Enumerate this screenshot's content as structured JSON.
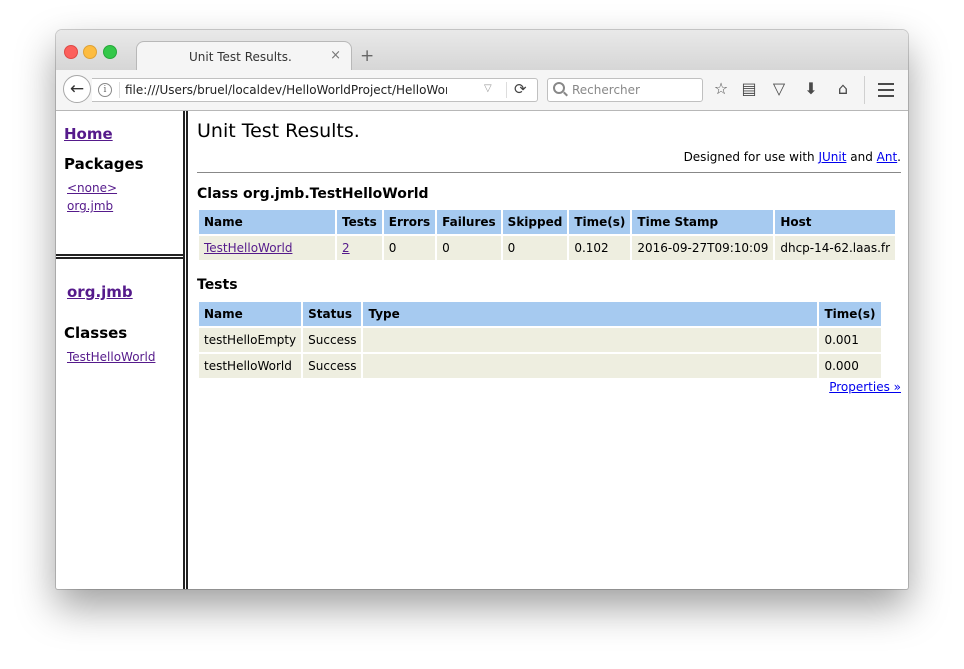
{
  "browser": {
    "tab_title": "Unit Test Results.",
    "tab_close": "×",
    "new_tab": "+",
    "url": "file:///Users/bruel/localdev/HelloWorldProject/HelloWorld/junit",
    "search_placeholder": "Rechercher"
  },
  "nav": {
    "home": "Home",
    "packages_heading": "Packages",
    "packages": [
      "<none>",
      "org.jmb"
    ],
    "package_name": "org.jmb",
    "classes_heading": "Classes",
    "classes": [
      "TestHelloWorld"
    ]
  },
  "main": {
    "title": "Unit Test Results.",
    "designed_prefix": "Designed for use with ",
    "junit": "JUnit",
    "and": " and ",
    "ant": "Ant",
    "period": ".",
    "class_heading": "Class org.jmb.TestHelloWorld",
    "summary_headers": [
      "Name",
      "Tests",
      "Errors",
      "Failures",
      "Skipped",
      "Time(s)",
      "Time Stamp",
      "Host"
    ],
    "summary_row": {
      "name": "TestHelloWorld",
      "tests": "2",
      "errors": "0",
      "failures": "0",
      "skipped": "0",
      "time": "0.102",
      "timestamp": "2016-09-27T09:10:09",
      "host": "dhcp-14-62.laas.fr"
    },
    "tests_heading": "Tests",
    "tests_headers": [
      "Name",
      "Status",
      "Type",
      "Time(s)"
    ],
    "tests": [
      {
        "name": "testHelloEmpty",
        "status": "Success",
        "type": "",
        "time": "0.001"
      },
      {
        "name": "testHelloWorld",
        "status": "Success",
        "type": "",
        "time": "0.000"
      }
    ],
    "properties": "Properties »"
  }
}
